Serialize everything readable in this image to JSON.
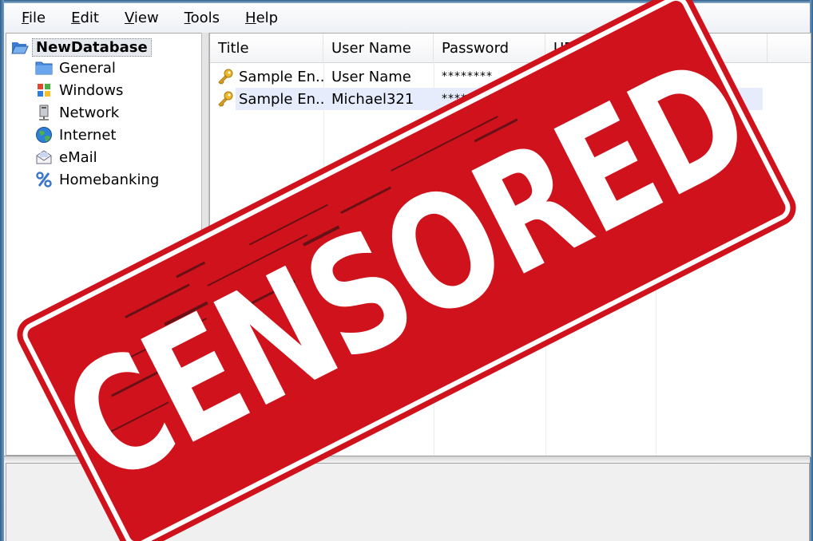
{
  "menu": [
    {
      "mnemonic": "F",
      "rest": "ile"
    },
    {
      "mnemonic": "E",
      "rest": "dit"
    },
    {
      "mnemonic": "V",
      "rest": "iew"
    },
    {
      "mnemonic": "T",
      "rest": "ools"
    },
    {
      "mnemonic": "H",
      "rest": "elp"
    }
  ],
  "tree": {
    "root": {
      "label": "NewDatabase",
      "icon": "folder-open-icon"
    },
    "groups": [
      {
        "label": "General",
        "icon": "folder-icon"
      },
      {
        "label": "Windows",
        "icon": "windows-icon"
      },
      {
        "label": "Network",
        "icon": "network-icon"
      },
      {
        "label": "Internet",
        "icon": "globe-icon"
      },
      {
        "label": "eMail",
        "icon": "email-icon"
      },
      {
        "label": "Homebanking",
        "icon": "percent-icon"
      }
    ]
  },
  "list": {
    "columns": [
      "Title",
      "User Name",
      "Password",
      "URL",
      ""
    ],
    "rows": [
      {
        "title": "Sample En...",
        "username": "User Name",
        "password": "********",
        "selected": false,
        "icon": "key-icon"
      },
      {
        "title": "Sample En...",
        "username": "Michael321",
        "password": "********",
        "selected": true,
        "icon": "key-icon"
      }
    ]
  },
  "stamp": {
    "text": "CENSORED",
    "color": "#d0121c"
  }
}
